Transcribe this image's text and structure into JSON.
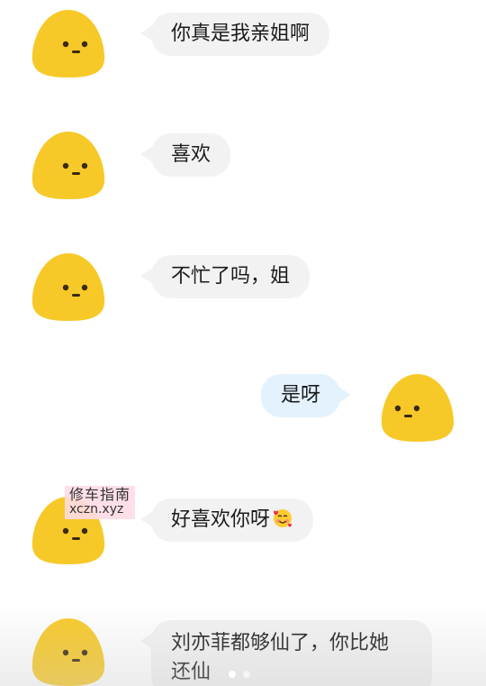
{
  "messages": [
    {
      "side": "left",
      "text": "你真是我亲姐啊"
    },
    {
      "side": "left",
      "text": "喜欢"
    },
    {
      "side": "left",
      "text": "不忙了吗，姐"
    },
    {
      "side": "right",
      "text": "是呀"
    },
    {
      "side": "left",
      "text": "好喜欢你呀",
      "emoji": "smiling-face-with-hearts-icon"
    },
    {
      "side": "left",
      "text_line1": "刘亦菲都够仙了，你比她",
      "text_line2": "还仙"
    }
  ],
  "watermark": {
    "title": "修车指南",
    "url": "xczn.xyz"
  },
  "carousel": {
    "pages": 2,
    "current": 1
  },
  "colors": {
    "avatar_yellow": "#F7C928",
    "left_bubble": "#F2F2F2",
    "right_bubble": "#E3F2FD",
    "watermark_bg": "#FFDCE6"
  }
}
